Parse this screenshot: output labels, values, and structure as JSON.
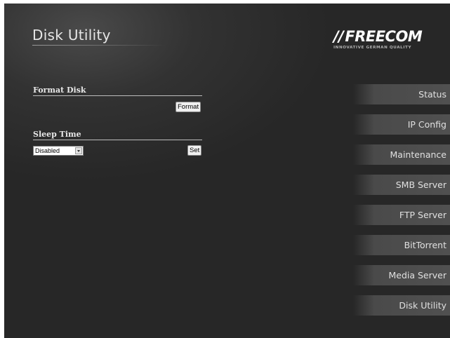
{
  "header": {
    "page_title": "Disk Utility",
    "logo": {
      "brand": "FREECOM",
      "tagline": "INNOVATIVE GERMAN QUALITY"
    }
  },
  "format_section": {
    "title": "Format Disk",
    "button_label": "Format"
  },
  "sleep_section": {
    "title": "Sleep Time",
    "select_value": "Disabled",
    "button_label": "Set"
  },
  "nav": {
    "items": [
      {
        "label": "Status"
      },
      {
        "label": "IP Config"
      },
      {
        "label": "Maintenance"
      },
      {
        "label": "SMB Server"
      },
      {
        "label": "FTP Server"
      },
      {
        "label": "BitTorrent"
      },
      {
        "label": "Media Server"
      },
      {
        "label": "Disk Utility"
      }
    ]
  },
  "colors": {
    "background": "#2b2b2b",
    "nav_item_bg": "#4e4e4e",
    "text": "#e6e6e6"
  }
}
